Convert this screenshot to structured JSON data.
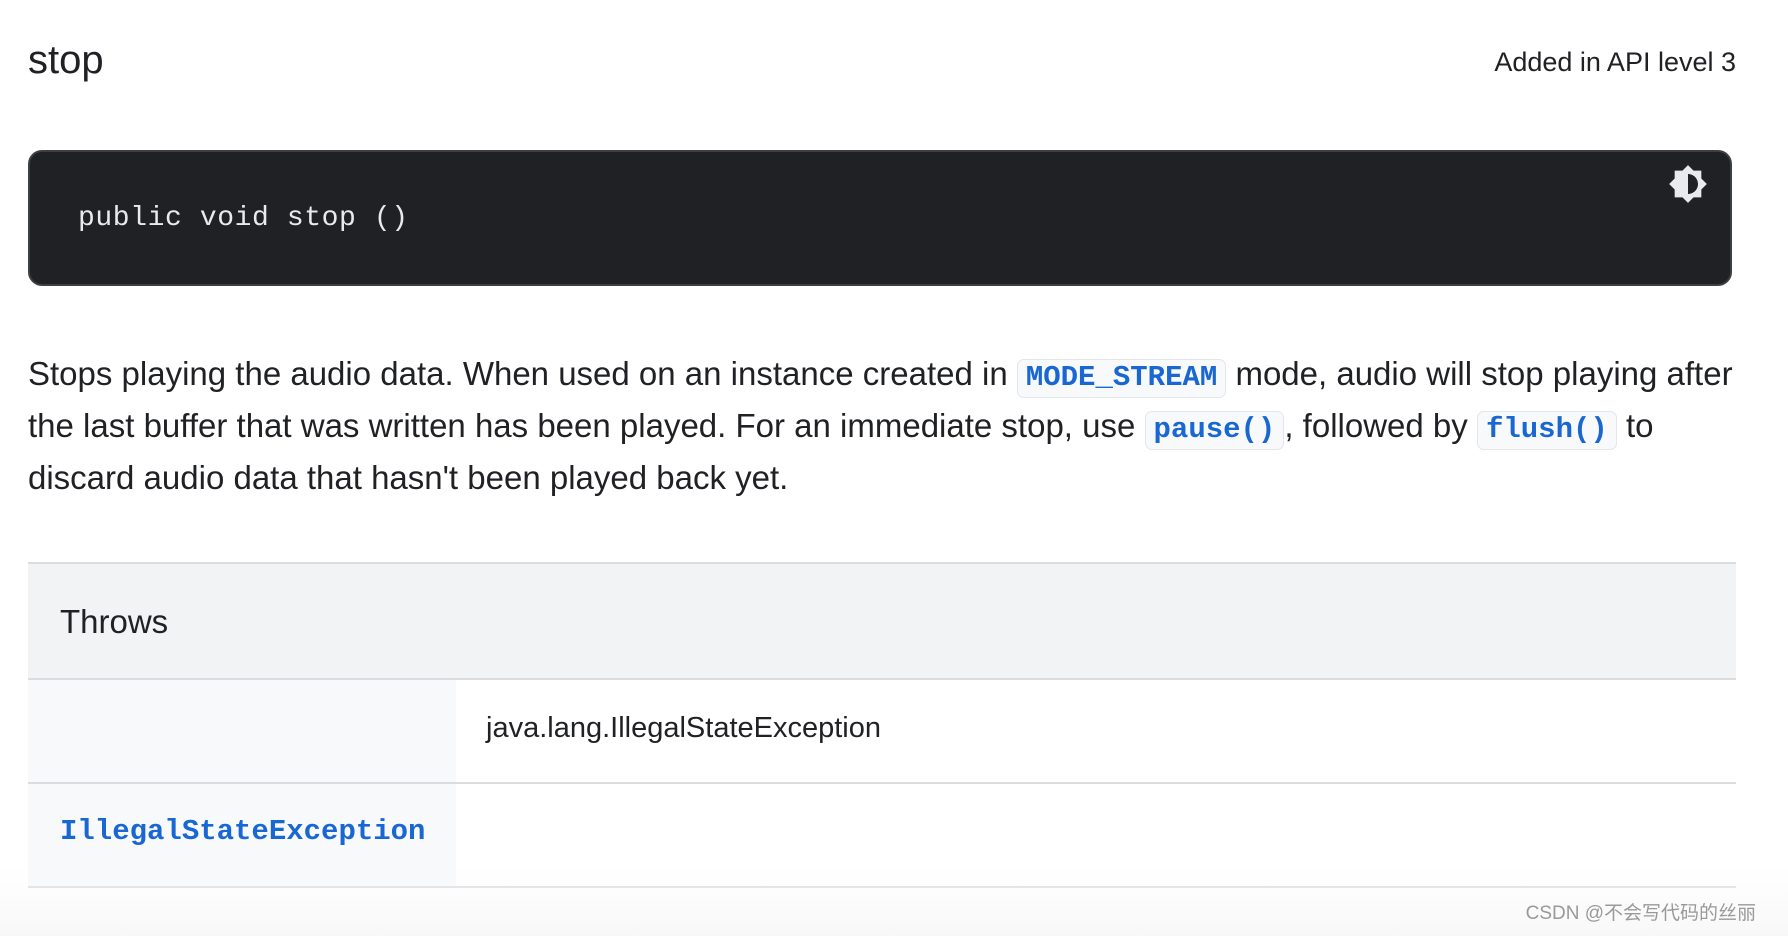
{
  "header": {
    "title": "stop",
    "api_level": "Added in API level 3"
  },
  "code_block": {
    "signature": "public void stop ()",
    "toggle_icon": "brightness-contrast-icon"
  },
  "description": {
    "part1": "Stops playing the audio data. When used on an instance created in ",
    "link_mode_stream": "MODE_STREAM",
    "part2": " mode, audio will stop playing after the last buffer that was written has been played. For an immediate stop, use ",
    "link_pause": "pause()",
    "part3": ", followed by ",
    "link_flush": "flush()",
    "part4": " to discard audio data that hasn't been played back yet."
  },
  "throws_table": {
    "header": "Throws",
    "rows": [
      {
        "exception": "",
        "description": "java.lang.IllegalStateException"
      },
      {
        "exception": "IllegalStateException",
        "description": ""
      }
    ]
  },
  "watermark": "CSDN @不会写代码的丝丽",
  "colors": {
    "code_bg": "#202124",
    "code_text": "#e8eaed",
    "link": "#1967d2",
    "table_header_bg": "#f1f3f4",
    "table_left_bg": "#f8f9fa",
    "border": "#dadce0"
  }
}
